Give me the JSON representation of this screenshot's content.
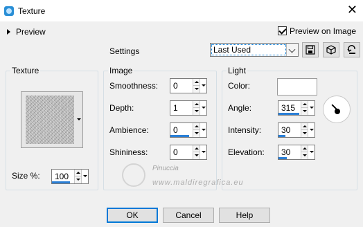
{
  "window": {
    "title": "Texture",
    "close_glyph": "✕",
    "icon": "app-icon"
  },
  "preview": {
    "label": "Preview",
    "preview_on_image_label": "Preview on Image",
    "preview_on_image_checked": true
  },
  "settings": {
    "label": "Settings",
    "selected": "Last Used",
    "tool_icons": [
      "save-preset-icon",
      "load-preset-icon",
      "reset-preset-icon"
    ]
  },
  "texture_group": {
    "title": "Texture",
    "size_label": "Size %:",
    "size_value": "100",
    "size_fill": 0.5
  },
  "image_group": {
    "title": "Image",
    "smoothness_label": "Smoothness:",
    "smoothness_value": "0",
    "depth_label": "Depth:",
    "depth_value": "1",
    "ambience_label": "Ambience:",
    "ambience_value": "0",
    "shininess_label": "Shininess:",
    "shininess_value": "0"
  },
  "light_group": {
    "title": "Light",
    "color_label": "Color:",
    "color_value": "#ffffff",
    "angle_label": "Angle:",
    "angle_value": "315",
    "intensity_label": "Intensity:",
    "intensity_value": "30",
    "elevation_label": "Elevation:",
    "elevation_value": "30"
  },
  "watermark": {
    "name": "Pinuccia",
    "url": "www.maldiregrafica.eu"
  },
  "buttons": {
    "ok": "OK",
    "cancel": "Cancel",
    "help": "Help"
  },
  "colors": {
    "accent": "#0078d7",
    "value_bar": "#2a7fd6",
    "background": "#f0f0f0"
  }
}
